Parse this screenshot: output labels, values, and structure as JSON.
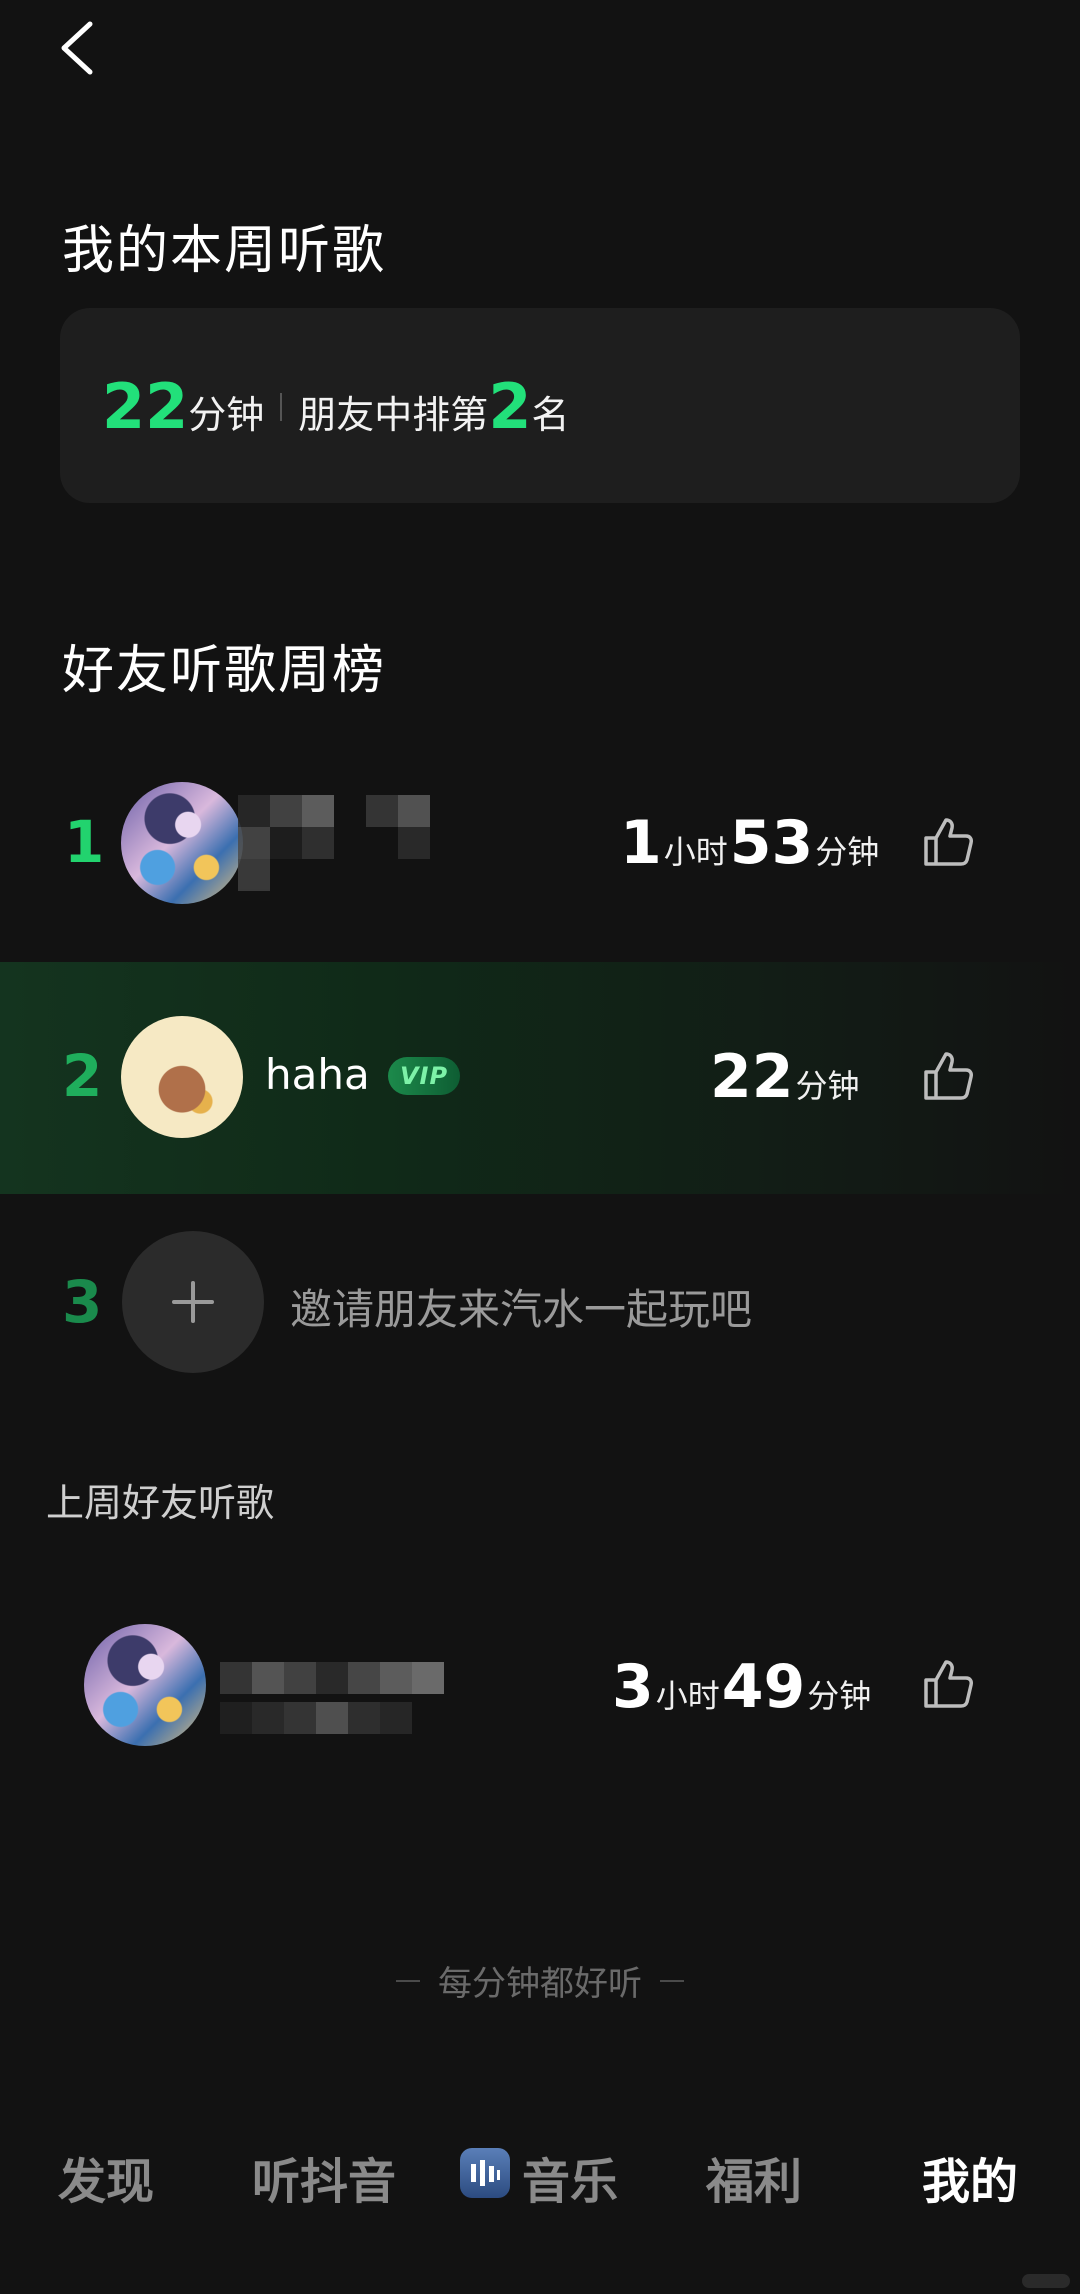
{
  "header": {
    "back_icon": "chevron-left-icon"
  },
  "weekly": {
    "title": "我的本周听歌",
    "minutes": "22",
    "minutes_unit": "分钟",
    "rank_prefix": "朋友中排第",
    "rank_value": "2",
    "rank_suffix": "名"
  },
  "leaderboard": {
    "title": "好友听歌周榜",
    "rows": [
      {
        "rank": "1",
        "name": "",
        "avatar": "anime-avatar",
        "duration": [
          "1",
          "小时",
          "53",
          "分钟"
        ],
        "highlight": false
      },
      {
        "rank": "2",
        "name": "haha",
        "badge": "VIP",
        "avatar": "cat-avatar",
        "duration": [
          "22",
          "分钟"
        ],
        "highlight": true
      }
    ],
    "invite": {
      "rank": "3",
      "text": "邀请朋友来汽水一起玩吧",
      "icon": "plus-icon"
    }
  },
  "last_week": {
    "title": "上周好友听歌",
    "duration": [
      "3",
      "小时",
      "49",
      "分钟"
    ]
  },
  "footer": {
    "slogan": "每分钟都好听"
  },
  "nav": {
    "items": [
      "发现",
      "听抖音",
      "音乐",
      "福利",
      "我的"
    ],
    "active": "我的"
  },
  "colors": {
    "accent": "#22e07a",
    "background": "#121212",
    "card": "#1e1e1e"
  }
}
